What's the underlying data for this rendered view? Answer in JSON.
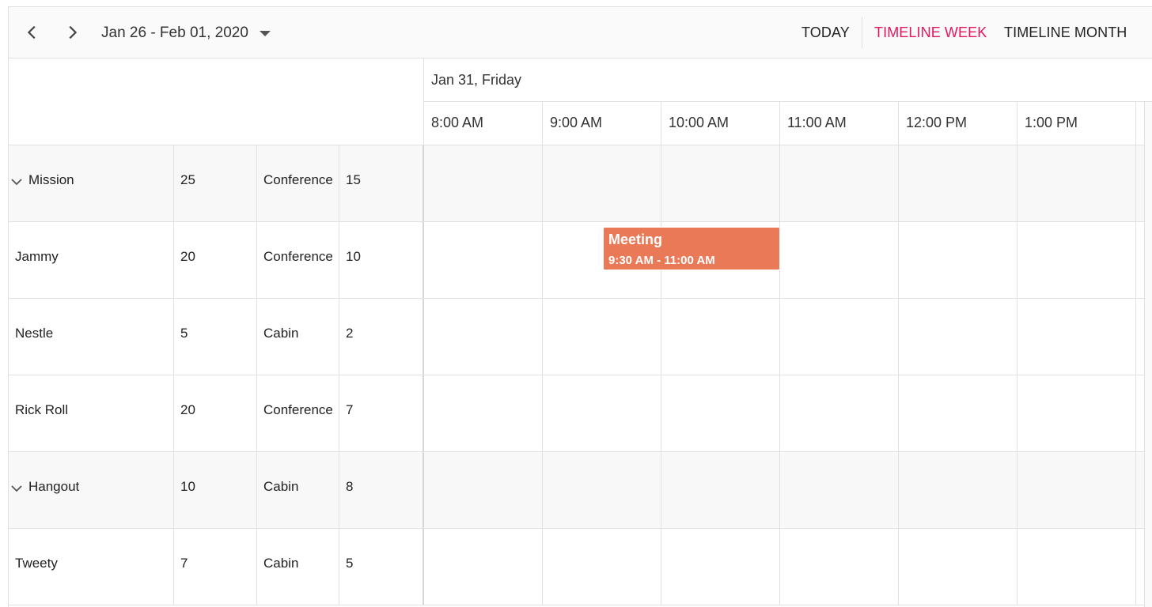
{
  "toolbar": {
    "date_range": "Jan 26 - Feb 01, 2020",
    "today_label": "TODAY",
    "timeline_week_label": "TIMELINE WEEK",
    "timeline_month_label": "TIMELINE MONTH",
    "active_view_color": "#e3165b"
  },
  "date_header": "Jan 31, Friday",
  "time_slots": [
    "8:00 AM",
    "9:00 AM",
    "10:00 AM",
    "11:00 AM",
    "12:00 PM",
    "1:00 PM"
  ],
  "resources": [
    {
      "name": "Mission",
      "capacity": "25",
      "type": "Conference",
      "count": "15",
      "is_parent": true
    },
    {
      "name": "Jammy",
      "capacity": "20",
      "type": "Conference",
      "count": "10",
      "is_parent": false
    },
    {
      "name": "Nestle",
      "capacity": "5",
      "type": "Cabin",
      "count": "2",
      "is_parent": false
    },
    {
      "name": "Rick Roll",
      "capacity": "20",
      "type": "Conference",
      "count": "7",
      "is_parent": false
    },
    {
      "name": "Hangout",
      "capacity": "10",
      "type": "Cabin",
      "count": "8",
      "is_parent": true
    },
    {
      "name": "Tweety",
      "capacity": "7",
      "type": "Cabin",
      "count": "5",
      "is_parent": false
    }
  ],
  "appointment": {
    "subject": "Meeting",
    "time": "9:30 AM - 11:00 AM",
    "color": "#ea7a57"
  }
}
